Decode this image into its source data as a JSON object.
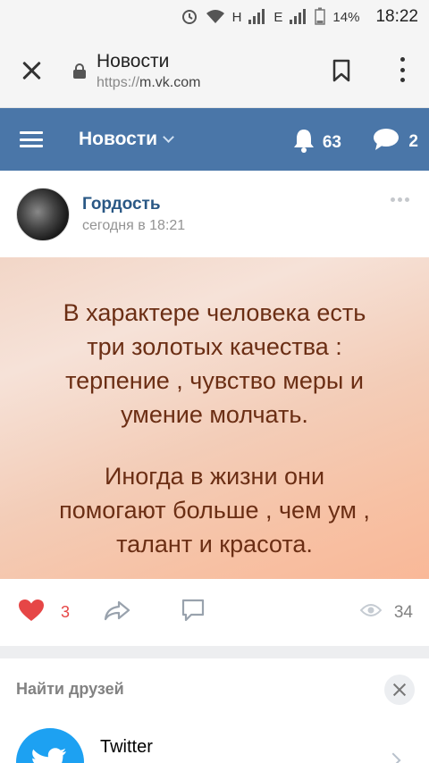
{
  "status_bar": {
    "network_1": "H",
    "network_2": "E",
    "battery": "14%",
    "time": "18:22"
  },
  "browser": {
    "page_title": "Новости",
    "url_proto": "https://",
    "url_host": "m.vk.com"
  },
  "header": {
    "title": "Новости",
    "notifications_count": "63",
    "messages_count": "2"
  },
  "post": {
    "author": "Гордость",
    "time": "сегодня в 18:21",
    "quote_1": "В характере человека есть\nтри золотых качества :\nтерпение , чувство меры и\nумение молчать.",
    "quote_2": "Иногда в жизни они\nпомогают больше , чем ум ,\nталант и красота.",
    "likes": "3",
    "views": "34"
  },
  "friends": {
    "title": "Найти друзей",
    "suggestion_name": "Twitter"
  },
  "colors": {
    "vk_blue": "#4a76a8",
    "link_blue": "#2a5885",
    "like_red": "#e64646",
    "twitter_blue": "#1da1f2"
  }
}
